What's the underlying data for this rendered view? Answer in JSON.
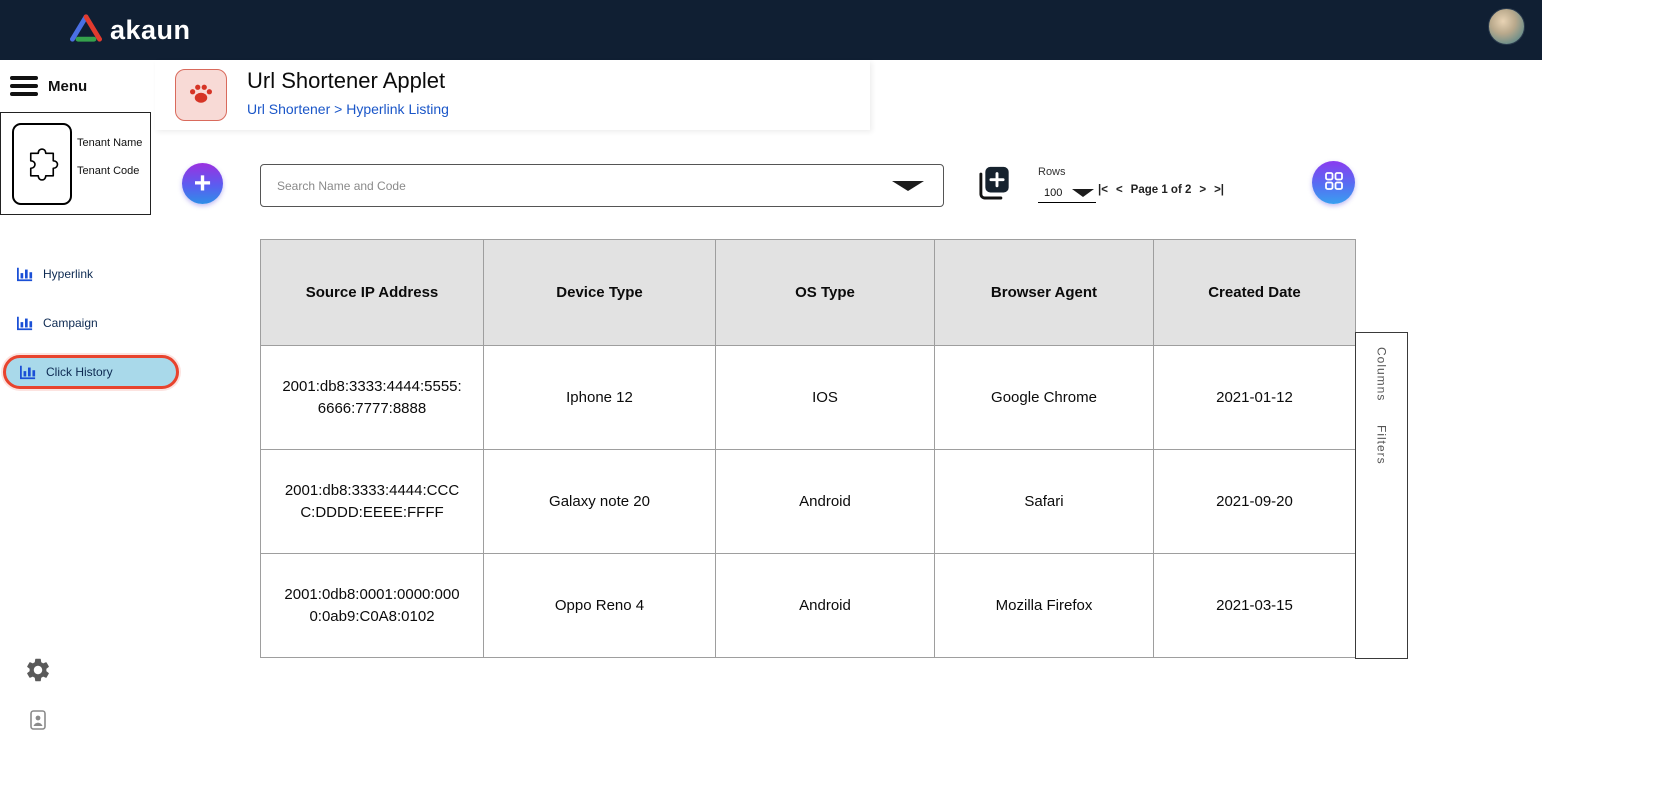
{
  "topbar": {
    "logo_text": "akaun"
  },
  "sidebar": {
    "menu_label": "Menu",
    "tenant": {
      "name_label": "Tenant Name",
      "code_label": "Tenant Code"
    },
    "items": [
      {
        "label": "Hyperlink"
      },
      {
        "label": "Campaign"
      },
      {
        "label": "Click History"
      }
    ]
  },
  "header": {
    "title": "Url Shortener Applet",
    "breadcrumb": "Url Shortener > Hyperlink Listing"
  },
  "toolbar": {
    "search_placeholder": "Search Name and Code",
    "rows_label": "Rows",
    "rows_value": "100",
    "pagination": {
      "first": "|<",
      "prev": "<",
      "page_label": "Page 1 of 2",
      "next": ">",
      "last": ">|"
    }
  },
  "table": {
    "columns": [
      "Source IP Address",
      "Device Type",
      "OS Type",
      "Browser Agent",
      "Created Date"
    ],
    "rows": [
      [
        "2001:db8:3333:4444:5555:6666:7777:8888",
        "Iphone 12",
        "IOS",
        "Google Chrome",
        "2021-01-12"
      ],
      [
        "2001:db8:3333:4444:CCCC:DDDD:EEEE:FFFF",
        "Galaxy note 20",
        "Android",
        "Safari",
        "2021-09-20"
      ],
      [
        "2001:0db8:0001:0000:0000:0ab9:C0A8:0102",
        "Oppo Reno 4",
        "Android",
        "Mozilla Firefox",
        "2021-03-15"
      ]
    ]
  },
  "side_panel": {
    "columns_label": "Columns",
    "filters_label": "Filters"
  },
  "icons": {
    "plus": "+"
  },
  "colors": {
    "topbar_bg": "#101f33",
    "breadcrumb_blue": "#1a56c8",
    "active_highlight": "#a9d9ea",
    "active_outline": "#e8432d",
    "table_header_bg": "#e2e2e2",
    "button_gradient_top": "#9b30e0",
    "button_gradient_bottom": "#2f8fe8"
  }
}
